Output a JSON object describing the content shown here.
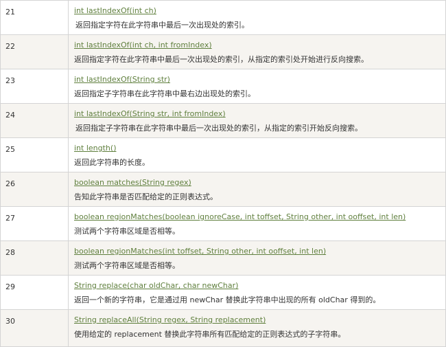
{
  "rows": [
    {
      "num": "21",
      "method": "int lastIndexOf(int ch)",
      "desc": "返回指定字符在此字符串中最后一次出现处的索引。"
    },
    {
      "num": "22",
      "method": "int lastIndexOf(int ch, int fromIndex)",
      "desc": "返回指定字符在此字符串中最后一次出现处的索引，从指定的索引处开始进行反向搜索。"
    },
    {
      "num": "23",
      "method": "int lastIndexOf(String str)",
      "desc": "返回指定子字符串在此字符串中最右边出现处的索引。"
    },
    {
      "num": "24",
      "method": "int lastIndexOf(String str, int fromIndex)",
      "desc": "返回指定子字符串在此字符串中最后一次出现处的索引，从指定的索引开始反向搜索。"
    },
    {
      "num": "25",
      "method": "int length()",
      "desc": "返回此字符串的长度。"
    },
    {
      "num": "26",
      "method": "boolean matches(String regex)",
      "desc": "告知此字符串是否匹配给定的正则表达式。"
    },
    {
      "num": "27",
      "method": "boolean regionMatches(boolean ignoreCase, int toffset, String other, int ooffset, int len)",
      "desc": "测试两个字符串区域是否相等。"
    },
    {
      "num": "28",
      "method": "boolean regionMatches(int toffset, String other, int ooffset, int len)",
      "desc": "测试两个字符串区域是否相等。"
    },
    {
      "num": "29",
      "method": "String replace(char oldChar, char newChar)",
      "desc": "返回一个新的字符串，它是通过用 newChar 替换此字符串中出现的所有 oldChar 得到的。"
    },
    {
      "num": "30",
      "method": "String replaceAll(String regex, String replacement)",
      "desc": "使用给定的 replacement 替换此字符串所有匹配给定的正则表达式的子字符串。"
    }
  ]
}
